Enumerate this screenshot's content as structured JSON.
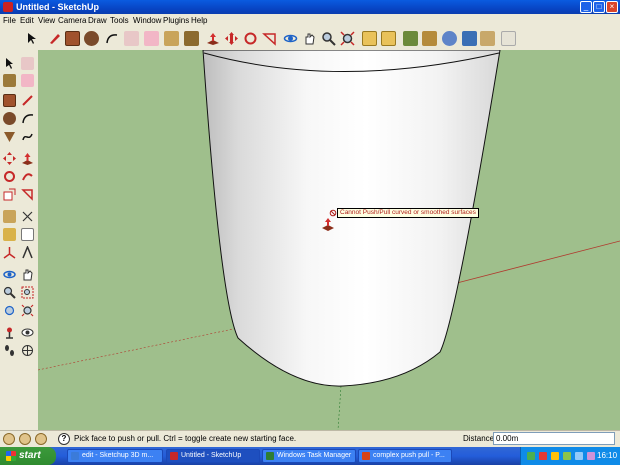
{
  "window": {
    "title": "Untitled - SketchUp"
  },
  "menu": [
    "File",
    "Edit",
    "View",
    "Camera",
    "Draw",
    "Tools",
    "Window",
    "Plugins",
    "Help"
  ],
  "viewport": {
    "tooltip": "Cannot Push/Pull curved or smoothed surfaces"
  },
  "status": {
    "hint": "Pick face to push or pull.  Ctrl = toggle create new starting face.",
    "distance_label": "Distance",
    "distance_value": "0.00m"
  },
  "taskbar": {
    "start_label": "start",
    "tasks": [
      {
        "label": "edit - Sketchup 3D m...",
        "icon_color": "#3B7BD9"
      },
      {
        "label": "Untitled - SketchUp",
        "icon_color": "#C62828"
      },
      {
        "label": "Windows Task Manager",
        "icon_color": "#2E7D32"
      },
      {
        "label": "complex push pull - P...",
        "icon_color": "#D84315"
      }
    ],
    "clock": "16:10"
  },
  "colors": {
    "sky": "#9FBF8C",
    "cylinder": "#FFFFFF",
    "tooltip_text": "#B0211C",
    "titlebar": "#0A5BE0"
  }
}
